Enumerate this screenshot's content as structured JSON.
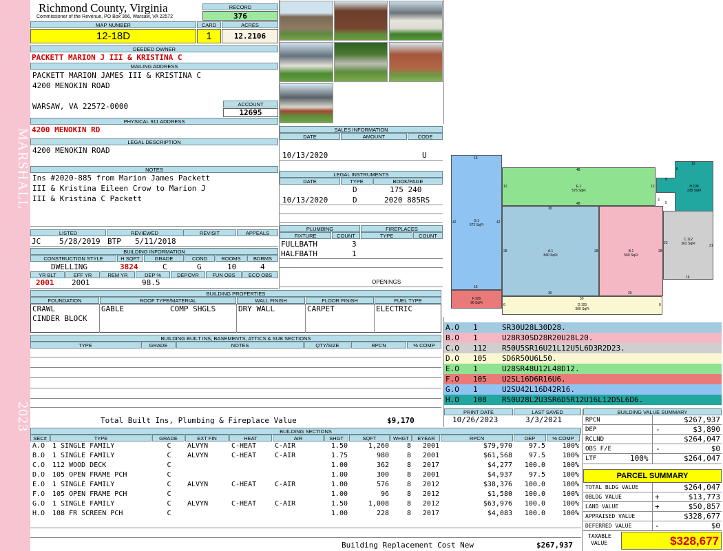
{
  "header": {
    "county": "Richmond County, Virginia",
    "commissioner": "Commissioner of the Revenue, PO Box 366, Warsaw, VA 22572",
    "record_label": "RECORD",
    "record": "376",
    "map_label": "MAP NUMBER",
    "map": "12-18D",
    "card_label": "CARD",
    "card": "1",
    "acres_label": "ACRES",
    "acres": "12.2106"
  },
  "owner": {
    "deeded_label": "DEEDED OWNER",
    "deeded": "PACKETT MARION J III & KRISTINA C",
    "mailing_label": "MAILING ADDRESS",
    "mail_line1": "PACKETT MARION JAMES III & KRISTINA C",
    "mail_line2": "4200 MENOKIN ROAD",
    "mail_line3": "WARSAW, VA 22572-0000",
    "account_label": "ACCOUNT",
    "account": "12695",
    "p911_label": "PHYSICAL 911 ADDRESS",
    "p911": "4200 MENOKIN RD",
    "legal_label": "LEGAL DESCRIPTION",
    "legal": "4200 MENOKIN ROAD",
    "notes_label": "NOTES",
    "notes1": "Ins #2020-885 from Marion James Packett",
    "notes2": "III & Kristina Eileen Crow to Marion J",
    "notes3": "III & Kristina C Packett"
  },
  "review": {
    "listed_label": "LISTED",
    "reviewed_label": "REVIEWED",
    "revisit_label": "REVISIT",
    "appeals_label": "APPEALS",
    "listed_by": "JC",
    "listed_date": "5/28/2019",
    "reviewed_by": "BTP",
    "reviewed_date": "5/11/2018"
  },
  "building_info": {
    "label": "BUILDING INFORMATION",
    "h_style": "CONSTRUCTION STYLE",
    "h_sqft": "H SQFT",
    "h_grade": "GRADE",
    "h_cond": "COND",
    "h_rooms": "ROOMS",
    "h_bdrms": "BDRMS",
    "style": "DWELLING",
    "sqft": "3824",
    "grade": "C",
    "cond": "G",
    "rooms": "10",
    "bdrms": "4",
    "h_yrblt": "YR BLT",
    "h_effyr": "EFF YR",
    "h_remyr": "REM YR",
    "h_dep": "DEP %",
    "h_depovr": "DEPOVR",
    "h_funobs": "FUN OBS",
    "h_ecoobs": "ECO OBS",
    "yrblt": "2001",
    "effyr": "2001",
    "dep": "98.5"
  },
  "sales": {
    "label": "SALES INFORMATION",
    "h_date": "DATE",
    "h_amount": "AMOUNT",
    "h_code": "CODE",
    "date": "10/13/2020",
    "code": "U"
  },
  "legal_instr": {
    "label": "LEGAL INSTRUMENTS",
    "h_date": "DATE",
    "h_type": "TYPE",
    "h_book": "BOOK/PAGE",
    "rows": [
      {
        "date": "",
        "type": "D",
        "book": "175 240"
      },
      {
        "date": "10/13/2020",
        "type": "D",
        "book": "2020 885RS"
      }
    ]
  },
  "plumbing": {
    "label": "PLUMBING",
    "h_fixture": "FIXTURE",
    "h_count": "COUNT",
    "rows": [
      {
        "fixture": "FULLBATH",
        "count": "3"
      },
      {
        "fixture": "HALFBATH",
        "count": "1"
      }
    ],
    "fp_label": "FIREPLACES",
    "fp_type": "TYPE",
    "fp_count": "COUNT",
    "openings": "OPENINGS"
  },
  "props": {
    "label": "BUILDING PROPERTIES",
    "h_found": "FOUNDATION",
    "h_roof": "ROOF TYPE/MATERIAL",
    "h_wall": "WALL FINISH",
    "h_floor": "FLOOR FINISH",
    "h_fuel": "FUEL TYPE",
    "found1": "CRAWL",
    "found2": "CINDER BLOCK",
    "roof_type": "GABLE",
    "roof_mat": "COMP SHGLS",
    "wall": "DRY WALL",
    "floor": "CARPET",
    "fuel": "ELECTRIC"
  },
  "builtins": {
    "label": "BUILDING BUILT INS, BASEMENTS, ATTICS & SUB SECTIONS",
    "h_type": "TYPE",
    "h_grade": "GRADE",
    "h_notes": "NOTES",
    "h_qty": "QTY/SIZE",
    "h_rpcn": "RPCN",
    "h_comp": "% COMP",
    "total_label": "Total Built Ins, Plumbing & Fireplace Value",
    "total": "$9,170"
  },
  "sections_codes": [
    {
      "sec": "A.O",
      "code": "1",
      "desc": "SR30U28L30D28.",
      "color": "#a3cbe0"
    },
    {
      "sec": "B.O",
      "code": "1",
      "desc": "U28R30SD28R20U28L20.",
      "color": "#f4b8c4"
    },
    {
      "sec": "C.O",
      "code": "112",
      "desc": "R50U5SR16U21L12U5L6D3R2D23.",
      "color": "#cfcfcf"
    },
    {
      "sec": "D.O",
      "code": "105",
      "desc": "SD6R50U6L50.",
      "color": "#fbf7d2"
    },
    {
      "sec": "E.O",
      "code": "1",
      "desc": "U28SR48U12L48D12.",
      "color": "#8fe28f"
    },
    {
      "sec": "F.O",
      "code": "105",
      "desc": "U2SL16D6R16U6.",
      "color": "#ea7a7a"
    },
    {
      "sec": "G.O",
      "code": "1",
      "desc": "U2SU42L16D42R16.",
      "color": "#8fc4f2"
    },
    {
      "sec": "H.O",
      "code": "108",
      "desc": "R50U28L2U3SR6D5R12U16L12D5L6D6.",
      "color": "#22a6a0"
    }
  ],
  "sketch": {
    "G": "G.1\n672 SqFt",
    "E": "E.1\n576 SqFt",
    "H": "H.108\n228 SqFt",
    "C": "C.112\n362 SqFt",
    "A": "A.1\n840 SqFt",
    "B": "B.1\n560 SqFt",
    "F": "F.105\n96 SqFt",
    "D": "D.105\n300 SqFt",
    "dims": [
      "16",
      "48",
      "12",
      "12",
      "5",
      "12",
      "6",
      "3",
      "5",
      "42",
      "42",
      "30",
      "48",
      "23",
      "21",
      "28",
      "28",
      "28",
      "16",
      "16",
      "30",
      "20",
      "6",
      "50",
      "6"
    ]
  },
  "dates": {
    "print_label": "PRINT DATE",
    "print": "10/26/2023",
    "saved_label": "LAST SAVED",
    "saved": "3/3/2021"
  },
  "value_summary": {
    "label": "BUILDING VALUE SUMMARY",
    "rpcn_l": "RPCN",
    "rpcn": "$267,937",
    "dep_l": "DEP",
    "dep_sign": "-",
    "dep": "$3,890",
    "rclnd_l": "RCLND",
    "rclnd": "$264,047",
    "obs_l": "OBS F/E",
    "obs_sign": "-",
    "obs": "$0",
    "ltf_l": "LTF",
    "ltf_pct": "100%",
    "ltf": "$264,047"
  },
  "parcel": {
    "label": "PARCEL SUMMARY",
    "tbv_l": "TOTAL BLDG VALUE",
    "tbv": "$264,047",
    "obv_l": "OBLDG VALUE",
    "obv_sign": "+",
    "obv": "$13,773",
    "lv_l": "LAND VALUE",
    "lv_sign": "+",
    "lv": "$50,857",
    "av_l": "APPRAISED VALUE",
    "av": "$328,677",
    "dv_l": "DEFERRED VALUE",
    "dv_sign": "-",
    "dv": "$0",
    "tax_l1": "TAXABLE",
    "tax_l2": "VALUE",
    "tax": "$328,677"
  },
  "sections": {
    "label": "BUILDING SECTIONS",
    "headers": [
      "SEC#",
      "TYPE",
      "GRADE",
      "EXT FIN",
      "HEAT",
      "AIR",
      "SHGT",
      "SQFT",
      "WHGT",
      "EYEAR",
      "RPCN",
      "DEP",
      "% COMP"
    ],
    "rows": [
      [
        "A.O",
        "1 SINGLE FAMILY",
        "C",
        "ALVYN",
        "C-HEAT",
        "C-AIR",
        "1.50",
        "1,260",
        "8",
        "2001",
        "$79,970",
        "97.5",
        "100%"
      ],
      [
        "B.O",
        "1 SINGLE FAMILY",
        "C",
        "ALVYN",
        "C-HEAT",
        "C-AIR",
        "1.75",
        "980",
        "8",
        "2001",
        "$61,568",
        "97.5",
        "100%"
      ],
      [
        "C.O",
        "112 WOOD DECK",
        "C",
        "",
        "",
        "",
        "1.00",
        "362",
        "8",
        "2017",
        "$4,277",
        "100.0",
        "100%"
      ],
      [
        "D.O",
        "105 OPEN FRAME PCH",
        "C",
        "",
        "",
        "",
        "1.00",
        "300",
        "8",
        "2001",
        "$4,937",
        "97.5",
        "100%"
      ],
      [
        "E.O",
        "1 SINGLE FAMILY",
        "C",
        "ALVYN",
        "C-HEAT",
        "C-AIR",
        "1.00",
        "576",
        "8",
        "2012",
        "$38,376",
        "100.0",
        "100%"
      ],
      [
        "F.O",
        "105 OPEN FRAME PCH",
        "C",
        "",
        "",
        "",
        "1.00",
        "96",
        "8",
        "2012",
        "$1,580",
        "100.0",
        "100%"
      ],
      [
        "G.O",
        "1 SINGLE FAMILY",
        "C",
        "ALVYN",
        "C-HEAT",
        "C-AIR",
        "1.50",
        "1,008",
        "8",
        "2012",
        "$63,976",
        "100.0",
        "100%"
      ],
      [
        "H.O",
        "108 FR SCREEN PCH",
        "C",
        "",
        "",
        "",
        "1.00",
        "228",
        "8",
        "2017",
        "$4,083",
        "100.0",
        "100%"
      ]
    ],
    "brcn_label": "Building Replacement Cost New",
    "brcn": "$267,937"
  },
  "sidebar": {
    "district": "MARSHALL",
    "year": "2023"
  }
}
